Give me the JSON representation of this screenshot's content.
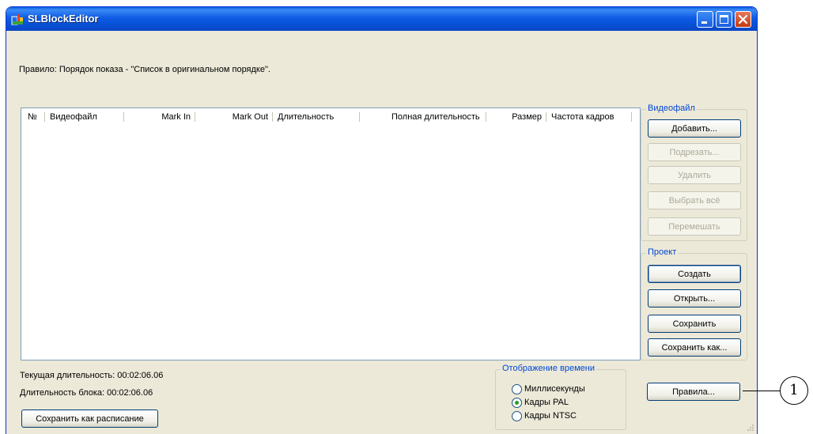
{
  "window": {
    "title": "SLBlockEditor"
  },
  "rule_text": "Правило: Порядок показа - \"Список в оригинальном порядке\".",
  "list": {
    "columns": [
      "№",
      "Видеофайл",
      "Mark In",
      "Mark Out",
      "Длительность",
      "Полная длительность",
      "Размер",
      "Частота кадров"
    ],
    "rows": []
  },
  "status": {
    "current_duration": "Текущая длительность: 00:02:06.06",
    "block_duration": "Длительность блока: 00:02:06.06"
  },
  "save_schedule_label": "Сохранить как расписание",
  "time_display": {
    "legend": "Отображение времени",
    "options": [
      "Миллисекунды",
      "Кадры PAL",
      "Кадры NTSC"
    ],
    "selected": "Кадры PAL"
  },
  "videofile_group": {
    "legend": "Видеофайл",
    "add": "Добавить...",
    "trim": "Подрезать...",
    "delete": "Удалить",
    "select_all": "Выбрать всё",
    "shuffle": "Перемешать"
  },
  "project_group": {
    "legend": "Проект",
    "create": "Создать",
    "open": "Открыть...",
    "save": "Сохранить",
    "save_as": "Сохранить как..."
  },
  "rules_button": "Правила...",
  "callout_number": "1",
  "colors": {
    "titlebar": "#0a47c4",
    "window_face": "#ece9d8",
    "group_legend": "#0046d5",
    "close_button": "#c43a12"
  },
  "icons": [
    "app-icon",
    "minimize-icon",
    "maximize-icon",
    "close-icon",
    "resize-grip-icon"
  ]
}
